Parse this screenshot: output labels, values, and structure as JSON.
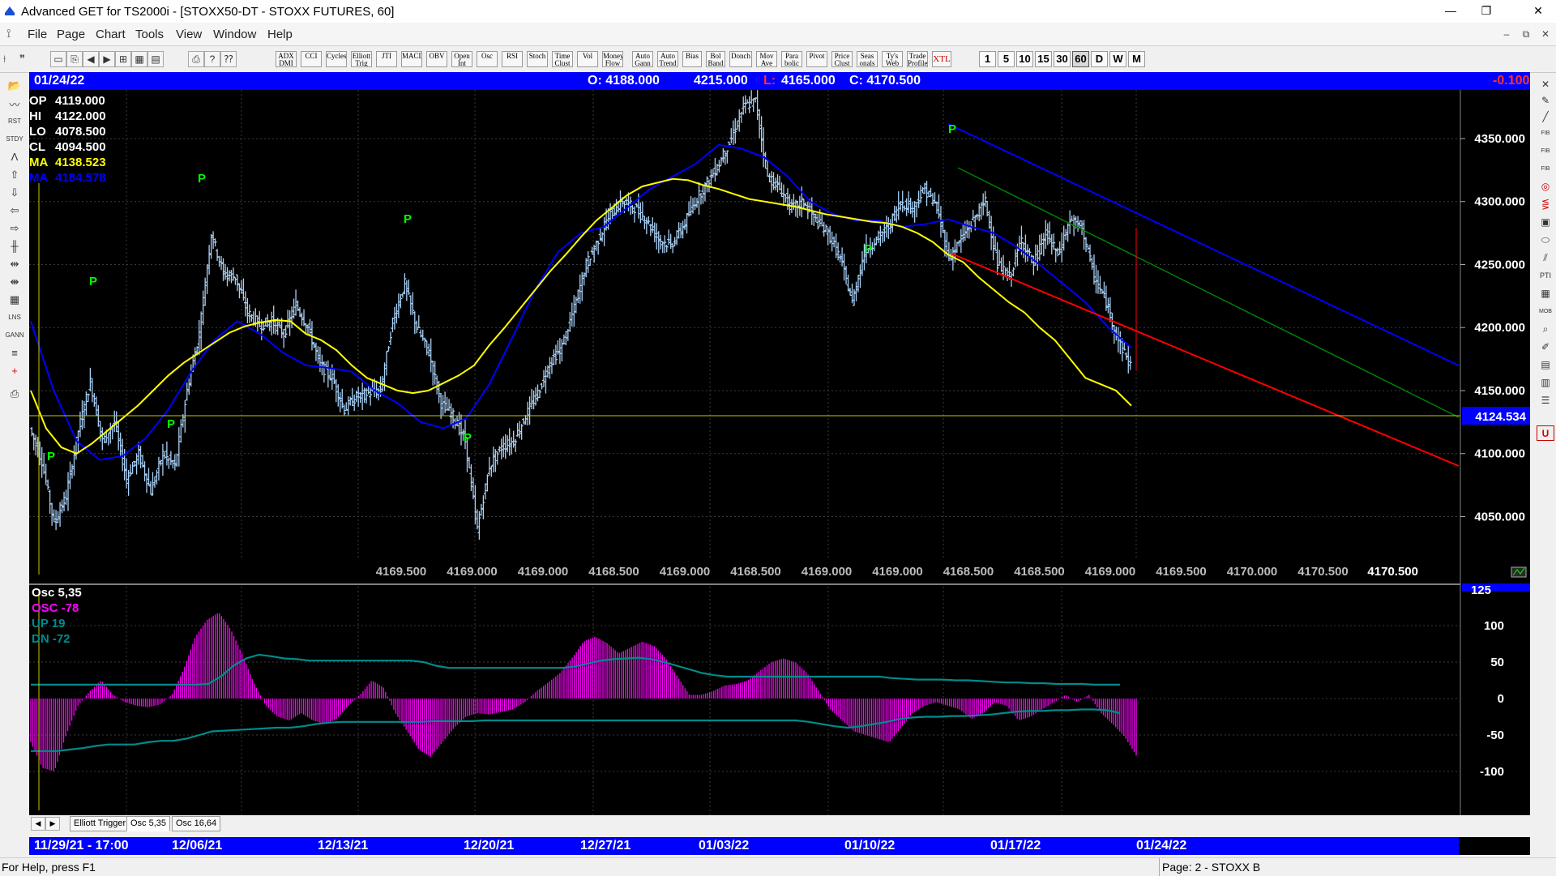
{
  "window": {
    "title": "Advanced GET for TS2000i - [STOXX50-DT - STOXX FUTURES, 60]",
    "minimize": "—",
    "maximize": "❐",
    "close": "✕"
  },
  "menu": {
    "items": [
      "File",
      "Page",
      "Chart",
      "Tools",
      "View",
      "Window",
      "Help"
    ],
    "mdi": {
      "minimize": "–",
      "restore": "⧉",
      "close": "✕"
    }
  },
  "toolbar": {
    "studies": [
      "ADX DMI",
      "CCI",
      "Cycles",
      "Elliott Trig",
      "JTI",
      "MACD",
      "OBV",
      "Open Int",
      "Osc",
      "RSI",
      "Stoch",
      "Time Clust",
      "Vol",
      "Money Flow",
      "Auto Gann",
      "Auto Trend",
      "Bias",
      "Bol Band",
      "Donch",
      "Mov Ave",
      "Para bolic",
      "Pivot",
      "Price Clust",
      "Seas onals",
      "Ty's Web",
      "Trade Profile",
      "XTL"
    ],
    "timeframes": [
      "1",
      "5",
      "10",
      "15",
      "30",
      "60",
      "D",
      "W",
      "M"
    ],
    "selected_timeframe": "60"
  },
  "infobar": {
    "date": "01/24/22",
    "open": "O: 4188.000",
    "high": "4215.000",
    "low_prefix": "L:",
    "low": "4165.000",
    "close": "C: 4170.500",
    "change": "-0.100"
  },
  "price_panel": {
    "legend": [
      {
        "label": "OP",
        "value": "4119.000",
        "color": "#ffffff"
      },
      {
        "label": "HI",
        "value": "4122.000",
        "color": "#ffffff"
      },
      {
        "label": "LO",
        "value": "4078.500",
        "color": "#ffffff"
      },
      {
        "label": "CL",
        "value": "4094.500",
        "color": "#ffffff"
      },
      {
        "label": "MA",
        "value": "4138.523",
        "color": "#ffff00"
      },
      {
        "label": "MA",
        "value": "4184.578",
        "color": "#0000ff"
      }
    ],
    "price_scale": [
      "4350.000",
      "4300.000",
      "4250.000",
      "4200.000",
      "4150.000",
      "4100.000",
      "4050.000"
    ],
    "current_level": "4124.534",
    "bottom_values": [
      "4169.500",
      "4169.000",
      "4169.000",
      "4168.500",
      "4169.000",
      "4168.500",
      "4169.000",
      "4169.000",
      "4168.500",
      "4168.500",
      "4169.000",
      "4169.500",
      "4170.000",
      "4170.500"
    ],
    "last_value": "4170.500",
    "pivot_marker": "P",
    "colors": {
      "background": "#000000",
      "bars": "#a9d0f5",
      "ma_fast": "#ffff00",
      "ma_slow": "#0000ff",
      "channel_top": "#0000ff",
      "channel_mid": "#008000",
      "channel_bottom": "#ff0000",
      "level_line": "#c8c800",
      "pivot": "#00ff00"
    }
  },
  "osc_panel": {
    "legend": [
      {
        "label": "Osc 5,35",
        "color": "#ffffff"
      },
      {
        "label": "OSC -78",
        "color": "#ff00ff"
      },
      {
        "label": "UP   19",
        "color": "#008b8b"
      },
      {
        "label": "DN   -72",
        "color": "#008b8b"
      }
    ],
    "scale": [
      "125",
      "100",
      "50",
      "0",
      "-50",
      "-100"
    ],
    "colors": {
      "histogram": "#ff00ff",
      "bands": "#008b8b"
    }
  },
  "tabs": [
    "Elliott Trigger",
    "Osc 5,35",
    "Osc 16,64"
  ],
  "datebar": {
    "start": "11/29/21 - 17:00",
    "dates": [
      "12/06/21",
      "12/13/21",
      "12/20/21",
      "12/27/21",
      "01/03/22",
      "01/10/22",
      "01/17/22",
      "01/24/22"
    ]
  },
  "status": {
    "help": "For Help, press F1",
    "page": "Page: 2 - STOXX B"
  },
  "chart_data": [
    {
      "type": "line",
      "ylim": [
        4020,
        4380
      ],
      "series": [
        {
          "values": [
            4120,
            4094,
            4045,
            4066,
            4118,
            4157,
            4110,
            4125,
            4080,
            4100,
            4070,
            4100,
            4090,
            4150,
            4195,
            4275,
            4243,
            4240,
            4212,
            4202,
            4205,
            4195,
            4218,
            4200,
            4170,
            4160,
            4135,
            4145,
            4148,
            4150,
            4205,
            4235,
            4200,
            4180,
            4140,
            4130,
            4110,
            4040,
            4090,
            4105,
            4110,
            4130,
            4148,
            4172,
            4185,
            4215,
            4250,
            4270,
            4290,
            4300,
            4295,
            4285,
            4270,
            4265,
            4280,
            4300,
            4315,
            4330,
            4350,
            4375,
            4380,
            4320,
            4310,
            4295,
            4300,
            4285,
            4275,
            4255,
            4220,
            4260,
            4270,
            4280,
            4300,
            4295,
            4310,
            4295,
            4255,
            4270,
            4285,
            4300,
            4250,
            4240,
            4270,
            4250,
            4275,
            4258,
            4285,
            4280,
            4240,
            4220,
            4190,
            4170
          ]
        },
        {
          "values": [
            4150,
            4120,
            4105,
            4100,
            4108,
            4118,
            4128,
            4138,
            4150,
            4162,
            4172,
            4180,
            4188,
            4196,
            4201,
            4204,
            4206,
            4205,
            4195,
            4190,
            4182,
            4170,
            4160,
            4155,
            4150,
            4148,
            4150,
            4156,
            4162,
            4170,
            4186,
            4200,
            4215,
            4230,
            4245,
            4258,
            4272,
            4285,
            4295,
            4305,
            4312,
            4315,
            4318,
            4317,
            4313,
            4310,
            4306,
            4302,
            4300,
            4298,
            4296,
            4293,
            4290,
            4288,
            4286,
            4284,
            4283,
            4280,
            4275,
            4268,
            4258,
            4252,
            4240,
            4230,
            4220,
            4212,
            4200,
            4190,
            4175,
            4160,
            4155,
            4150,
            4138
          ]
        },
        {
          "values": [
            4205,
            4150,
            4110,
            4095,
            4098,
            4112,
            4135,
            4165,
            4190,
            4205,
            4195,
            4180,
            4170,
            4168,
            4165,
            4150,
            4140,
            4125,
            4120,
            4128,
            4155,
            4192,
            4230,
            4260,
            4275,
            4280,
            4295,
            4310,
            4320,
            4330,
            4345,
            4342,
            4335,
            4320,
            4300,
            4290,
            4285,
            4285,
            4280,
            4282,
            4286,
            4280,
            4275,
            4264,
            4250,
            4235,
            4220,
            4200,
            4184
          ]
        }
      ]
    },
    {
      "type": "bar",
      "ylim": [
        -140,
        125
      ],
      "series": [
        {
          "name": "OSC",
          "values": [
            -60,
            -95,
            -100,
            -50,
            -10,
            10,
            25,
            5,
            -5,
            -10,
            -12,
            -8,
            5,
            40,
            85,
            108,
            118,
            95,
            60,
            20,
            -10,
            -25,
            -30,
            -20,
            -30,
            -35,
            -28,
            -10,
            5,
            25,
            15,
            -20,
            -45,
            -70,
            -80,
            -60,
            -40,
            -25,
            -20,
            -22,
            -18,
            -15,
            -5,
            10,
            22,
            35,
            55,
            78,
            85,
            76,
            62,
            70,
            78,
            72,
            55,
            30,
            5,
            5,
            10,
            18,
            20,
            25,
            38,
            50,
            55,
            50,
            35,
            10,
            -15,
            -30,
            -45,
            -50,
            -55,
            -60,
            -40,
            -20,
            -10,
            -5,
            -10,
            -15,
            -28,
            -20,
            -5,
            -10,
            -30,
            -25,
            -15,
            -5,
            5,
            -5,
            5,
            -20,
            -35,
            -52,
            -78
          ]
        },
        {
          "name": "UP",
          "values": [
            19,
            19,
            19,
            19,
            19,
            19,
            19,
            19,
            19,
            19,
            19,
            19,
            19,
            19,
            20,
            30,
            45,
            55,
            60,
            58,
            55,
            54,
            52,
            52,
            52,
            52,
            52,
            52,
            52,
            52,
            52,
            50,
            45,
            42,
            42,
            42,
            42,
            42,
            42,
            42,
            42,
            42,
            42,
            44,
            48,
            52,
            54,
            55,
            56,
            54,
            50,
            45,
            40,
            35,
            32,
            30,
            30,
            30,
            30,
            30,
            30,
            30,
            30,
            30,
            30,
            30,
            30,
            30,
            28,
            27,
            26,
            26,
            26,
            25,
            25,
            24,
            23,
            22,
            22,
            21,
            21,
            20,
            20,
            20,
            19,
            19,
            19
          ]
        },
        {
          "name": "DN",
          "values": [
            -72,
            -72,
            -72,
            -70,
            -68,
            -65,
            -63,
            -63,
            -63,
            -60,
            -58,
            -58,
            -55,
            -50,
            -45,
            -44,
            -43,
            -42,
            -41,
            -40,
            -40,
            -38,
            -35,
            -33,
            -32,
            -32,
            -32,
            -32,
            -32,
            -32,
            -32,
            -31,
            -31,
            -31,
            -31,
            -30,
            -30,
            -30,
            -30,
            -30,
            -30,
            -30,
            -30,
            -30,
            -30,
            -30,
            -30,
            -30,
            -30,
            -30,
            -30,
            -30,
            -30,
            -30,
            -30,
            -30,
            -30,
            -30,
            -30,
            -30,
            -32,
            -35,
            -38,
            -40,
            -38,
            -35,
            -32,
            -28,
            -26,
            -25,
            -25,
            -24,
            -24,
            -23,
            -22,
            -20,
            -18,
            -17,
            -17,
            -16,
            -16,
            -15,
            -15,
            -16,
            -20
          ]
        }
      ]
    }
  ]
}
